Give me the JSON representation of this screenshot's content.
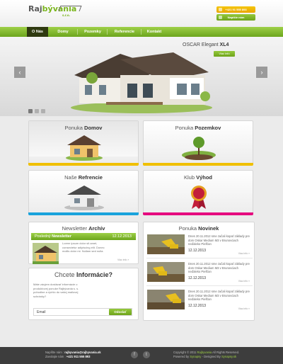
{
  "header": {
    "logo_text_a": "Raj",
    "logo_text_b": "bývania",
    "logo_sro": "s.r.o.",
    "phone_button": "+421 91 555 893",
    "write_button": "Napíšte nám"
  },
  "nav": {
    "items": [
      {
        "label": "O Nás"
      },
      {
        "label": "Domy"
      },
      {
        "label": "Pozemky"
      },
      {
        "label": "Referencie"
      },
      {
        "label": "Kontakt"
      }
    ]
  },
  "slider": {
    "title_a": "OSCAR Elegant ",
    "title_b": "XL4",
    "button": "Viac info",
    "prev_icon": "‹",
    "next_icon": "›"
  },
  "cards": [
    {
      "a": "Ponuka ",
      "b": "Domov"
    },
    {
      "a": "Ponuka ",
      "b": "Pozemkov"
    },
    {
      "a": "Naše ",
      "b": "Refrencie"
    },
    {
      "a": "Klub ",
      "b": "Výhod"
    }
  ],
  "newsletter": {
    "title_a": "Newsletter ",
    "title_b": "Archív",
    "bar_a": "Posledný ",
    "bar_b": "Newsletter",
    "date": "12.12.2013",
    "text": "Lorem ipsum dolor sit amet, consectetur adipiscing elit. Donec mollis dolor mi. Nullam sed nulla.",
    "more": "Viac info »"
  },
  "novinky": {
    "title_a": "Ponuka ",
    "title_b": "Novinek",
    "items": [
      {
        "text": "Dnes 20.11.2012 sme začali kopať základy pre dom Oskar Medium M3 v Brunovciach neďaleko Piešťan",
        "date": "12.12.2013",
        "more": "Viac info »"
      },
      {
        "text": "Dnes 20.11.2012 sme začali kopať základy pre dom Oskar Medium M3 v Brunovciach neďaleko Piešťan",
        "date": "12.12.2013",
        "more": "Viac info »"
      },
      {
        "text": "Dnes 20.11.2012 sme začali kopať základy pre dom Oskar Medium M3 v Brunovciach neďaleko Piešťan",
        "date": "12.12.2013",
        "more": "Viac info »"
      }
    ]
  },
  "info": {
    "title_a": "Chcete ",
    "title_b": "Informácie?",
    "text": "Máte záujem dostávať informácie o produktovej ponuke Rajbývania s. s. pohodlne a rýchlo do vašej mailovej schránky?",
    "email_value": "Email",
    "send": "Odoslať"
  },
  "footer": {
    "write_label": "Napíšte nám : ",
    "write_value": "rajbyvania@rajbyvania.sk",
    "call_label": "Zavolajte nám : ",
    "call_value": "+421 911 555 893",
    "fb": "f",
    "tw": "t",
    "copyright_a": "Copyright © 2011 ",
    "copyright_b": "Rajbyvania",
    "copyright_c": " All Rights Reserved.",
    "powered_a": "Powered by ",
    "powered_b": "Synapsy",
    "powered_c": " - Designed By ",
    "powered_d": "Synapsy.sk"
  },
  "colors": {
    "green": "#7ab51d",
    "yellow": "#f0c000",
    "blue": "#1aa3dc",
    "pink": "#e5097f"
  }
}
